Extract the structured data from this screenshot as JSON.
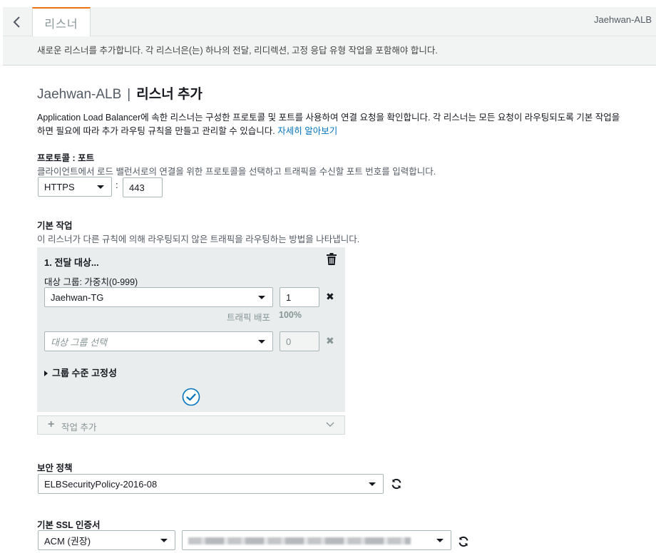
{
  "topbar": {
    "tab_label": "리스너",
    "user": "Jaehwan-ALB"
  },
  "info": {
    "text": "새로운 리스너를 추가합니다. 각 리스너은(는) 하나의 전달, 리디렉션, 고정 응답 유형 작업을 포함해야 합니다."
  },
  "heading": {
    "lb_name": "Jaehwan-ALB",
    "separator": "|",
    "title": "리스너 추가"
  },
  "description": {
    "line1": "Application Load Balancer에 속한 리스너는 구성한 프로토콜 및 포트를 사용하여 연결 요청을 확인합니다. 각 리스너는 모든 요청이 라우팅되도록 기본 작업을",
    "line2": "하면 필요에 따라 추가 라우팅 규칙을 만들고 관리할 수 있습니다.",
    "learn_more": "자세히 알아보기"
  },
  "protocol_port": {
    "title": "프로토콜 : 포트",
    "subtitle": "클라이언트에서 로드 밸런서로의 연결을 위한 프로토콜을 선택하고 트래픽을 수신할 포트 번호를 입력합니다.",
    "protocol": "HTTPS",
    "colon": ":",
    "port": "443"
  },
  "default_action": {
    "title": "기본 작업",
    "subtitle": "이 리스너가 다른 규칙에 의해 라우팅되지 않은 트래픽을 라우팅하는 방법을 나타냅니다.",
    "panel_title": "1. 전달 대상...",
    "target_group_label": "대상 그룹: 가중치(0-999)",
    "target_group_1": "Jaehwan-TG",
    "weight_1": "1",
    "traffic_dist_label": "트래픽 배포",
    "traffic_dist_value": "100%",
    "target_group_2_placeholder": "대상 그룹 선택",
    "weight_2": "0",
    "stickiness": "그룹 수준 고정성",
    "add_action": "작업 추가"
  },
  "security_policy": {
    "title": "보안 정책",
    "value": "ELBSecurityPolicy-2016-08"
  },
  "ssl_cert": {
    "title": "기본 SSL 인증서",
    "source": "ACM (권장)"
  }
}
